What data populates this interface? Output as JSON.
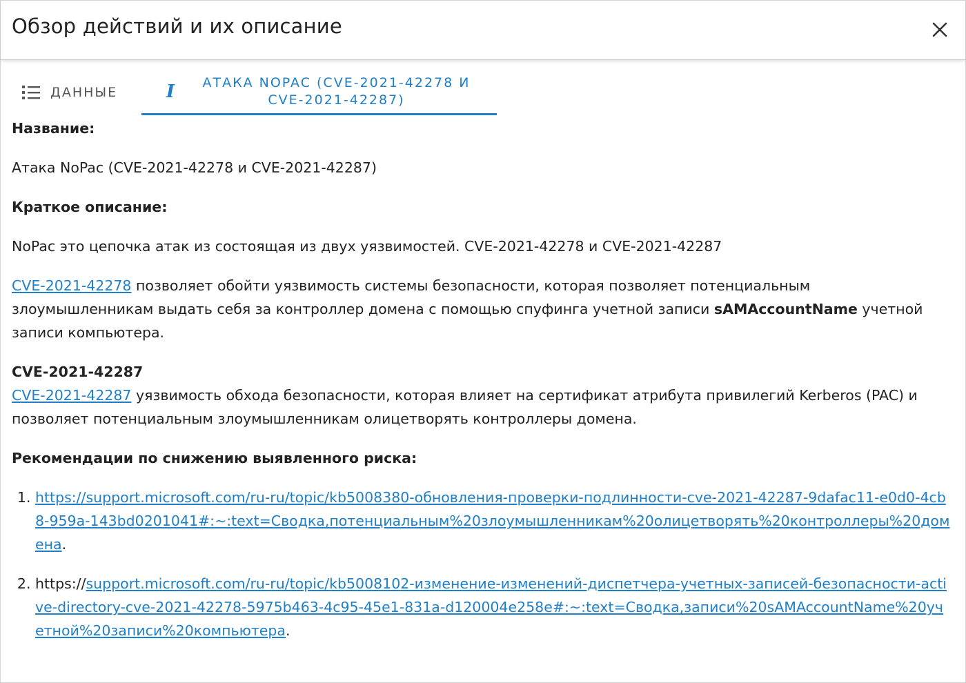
{
  "dialog": {
    "title": "Обзор действий и их описание",
    "close_icon": "close-icon"
  },
  "tabs": [
    {
      "label": "Данные",
      "icon": "list-icon",
      "active": false
    },
    {
      "label": "Атака NoPac (CVE-2021-42278 и CVE-2021-42287)",
      "icon": "info-icon",
      "icon_glyph": "i",
      "active": true
    }
  ],
  "colors": {
    "accent": "#1f7fc8",
    "text": "#222222",
    "muted": "#555555"
  },
  "content": {
    "name_heading": "Название:",
    "name_value": "Атака NoPac (CVE-2021-42278 и CVE-2021-42287)",
    "summary_heading": "Краткое описание:",
    "summary_text": "NoPac это цепочка атак из состоящая из двух уязвимостей. CVE-2021-42278 и CVE-2021-42287",
    "cve1": {
      "link_text": "CVE-2021-42278",
      "text_before_bold": " позволяет обойти уязвимость системы безопасности, которая позволяет потенциальным злоумышленникам выдать себя за контроллер домена с помощью спуфинга учетной записи ",
      "bold_text": "sAMAccountName",
      "text_after_bold": " учетной записи компьютера."
    },
    "cve2": {
      "heading": "CVE-2021-42287",
      "link_text": "CVE-2021-42287",
      "text": " уязвимость обхода безопасности, которая влияет на сертификат атрибута привилегий Kerberos (PAC) и позволяет потенциальным злоумышленникам олицетворять контроллеры домена."
    },
    "recommendations_heading": "Рекомендации по снижению выявленного риска:",
    "recommendations": [
      {
        "prefix": "",
        "link": "https://support.microsoft.com/ru-ru/topic/kb5008380-обновления-проверки-подлинности-cve-2021-42287-9dafac11-e0d0-4cb8-959a-143bd0201041#:~:text=Сводка,потенциальным%20злоумышленникам%20олицетворять%20контроллеры%20домена",
        "suffix": "."
      },
      {
        "prefix": "https://",
        "link": "support.microsoft.com/ru-ru/topic/kb5008102-изменение-изменений-диспетчера-учетных-записей-безопасности-active-directory-cve-2021-42278-5975b463-4c95-45e1-831a-d120004e258e#:~:text=Сводка,записи%20sAMAccountName%20учетной%20записи%20компьютера",
        "suffix": "."
      }
    ]
  }
}
